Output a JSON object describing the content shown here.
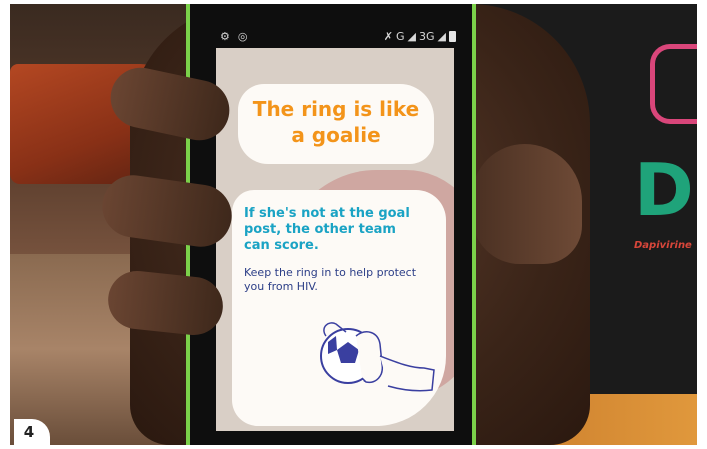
{
  "screen": {
    "title_line1": "The ring is like",
    "title_line2": "a goalie",
    "message_strong": "If she's not at the goal post, the other team can score.",
    "message_normal": "Keep the ring in to help protect you from HIV."
  },
  "statusbar": {
    "network_text": "G",
    "signal_text": "3G"
  },
  "shirt": {
    "logo_letter": "D",
    "caption": "Dapivirine"
  },
  "figure": {
    "badge_number": "4"
  },
  "colors": {
    "title": "#f3941a",
    "message_strong": "#1aa3c4",
    "message_normal": "#2c3e87",
    "phone_frame": "#7bd14a"
  }
}
